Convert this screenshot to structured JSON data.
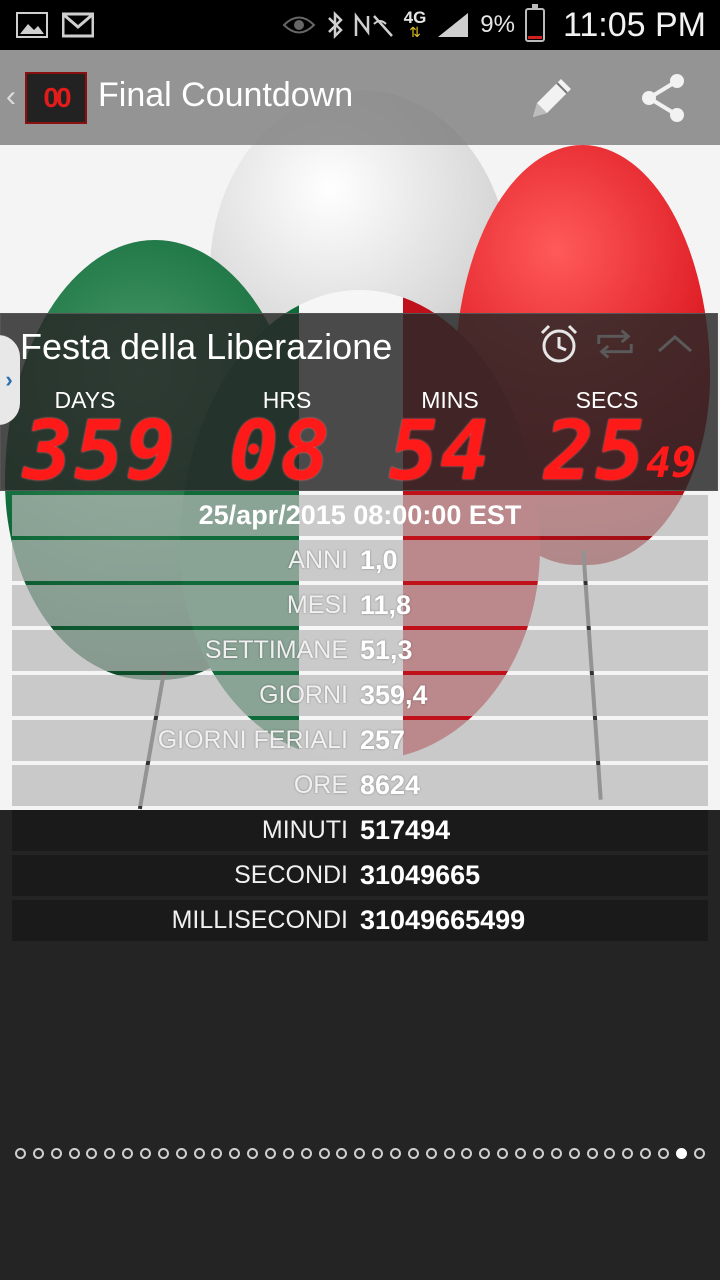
{
  "status_bar": {
    "battery_percent": "9%",
    "time": "11:05 PM",
    "network": "4G",
    "battery_level": 0.09
  },
  "action_bar": {
    "title": "Final Countdown",
    "logo_text": "00"
  },
  "countdown": {
    "event_title": "Festa della Liberazione",
    "units": [
      {
        "label": "DAYS",
        "value": "359"
      },
      {
        "label": "HRS",
        "value": "08"
      },
      {
        "label": "MINS",
        "value": "54"
      },
      {
        "label": "SECS",
        "value": "25"
      }
    ],
    "hundredths": "49",
    "target_date": "25/apr/2015 08:00:00 EST"
  },
  "stats": [
    {
      "label": "ANNI",
      "value": "1,0"
    },
    {
      "label": "MESI",
      "value": "11,8"
    },
    {
      "label": "SETTIMANE",
      "value": "51,3"
    },
    {
      "label": "GIORNI",
      "value": "359,4"
    },
    {
      "label": "GIORNI FERIALI",
      "value": "257"
    },
    {
      "label": "ORE",
      "value": "8624"
    },
    {
      "label": "MINUTI",
      "value": "517494"
    },
    {
      "label": "SECONDI",
      "value": "31049665"
    },
    {
      "label": "MILLISECONDI",
      "value": "31049665499"
    }
  ],
  "page_indicator": {
    "total": 39,
    "active_index": 37
  },
  "colors": {
    "digit_red": "#ff1a1a",
    "action_bar_bg": "#787878",
    "panel_bg": "#282828"
  }
}
